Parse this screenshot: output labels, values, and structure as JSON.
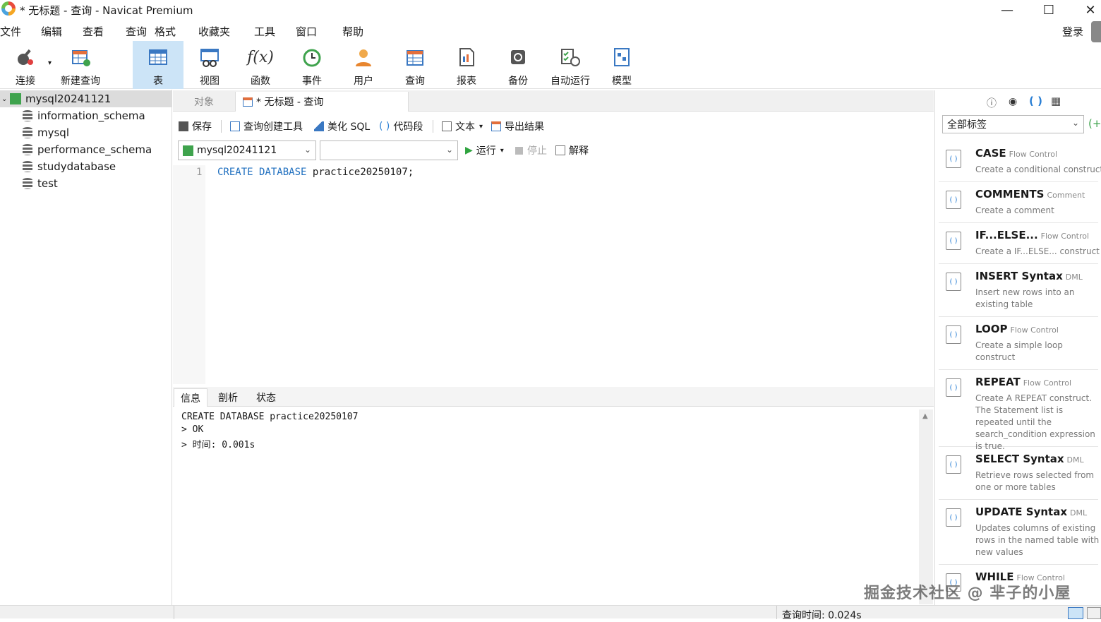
{
  "window": {
    "title": "* 无标题 - 查询 - Navicat Premium"
  },
  "menu": [
    "文件",
    "编辑",
    "查看",
    "查询",
    "格式",
    "收藏夹",
    "工具",
    "窗口",
    "帮助"
  ],
  "login_label": "登录",
  "toolbar": [
    {
      "label": "连接",
      "icon": "plug-icon"
    },
    {
      "label": "新建查询",
      "icon": "new-query-icon"
    },
    {
      "label": "表",
      "icon": "table-icon"
    },
    {
      "label": "视图",
      "icon": "view-icon"
    },
    {
      "label": "函数",
      "icon": "function-icon"
    },
    {
      "label": "事件",
      "icon": "clock-icon"
    },
    {
      "label": "用户",
      "icon": "user-icon"
    },
    {
      "label": "查询",
      "icon": "query-icon"
    },
    {
      "label": "报表",
      "icon": "report-icon"
    },
    {
      "label": "备份",
      "icon": "backup-icon"
    },
    {
      "label": "自动运行",
      "icon": "auto-run-icon"
    },
    {
      "label": "模型",
      "icon": "model-icon"
    }
  ],
  "tree": {
    "connection": "mysql20241121",
    "databases": [
      "information_schema",
      "mysql",
      "performance_schema",
      "studydatabase",
      "test"
    ]
  },
  "tabs": {
    "objects": "对象",
    "query": "* 无标题 - 查询"
  },
  "query_toolbar": {
    "save": "保存",
    "builder": "查询创建工具",
    "beautify": "美化 SQL",
    "snippet": "代码段",
    "text": "文本",
    "export": "导出结果"
  },
  "run_row": {
    "connection": "mysql20241121",
    "database": "",
    "run": "运行",
    "stop": "停止",
    "explain": "解释"
  },
  "editor": {
    "line_number": "1",
    "keyword1": "CREATE",
    "keyword2": "DATABASE",
    "rest": "practice20250107;"
  },
  "result_tabs": [
    "信息",
    "剖析",
    "状态"
  ],
  "result_lines": [
    "CREATE DATABASE practice20250107",
    "> OK",
    "> 时间: 0.001s"
  ],
  "right_panel": {
    "tag_filter": "全部标签",
    "snippets": [
      {
        "title": "CASE",
        "tag": "Flow Control",
        "desc": "Create a conditional construct"
      },
      {
        "title": "COMMENTS",
        "tag": "Comment",
        "desc": "Create a comment"
      },
      {
        "title": "IF...ELSE...",
        "tag": "Flow Control",
        "desc": "Create a IF...ELSE... construct"
      },
      {
        "title": "INSERT Syntax",
        "tag": "DML",
        "desc": "Insert new rows into an existing table"
      },
      {
        "title": "LOOP",
        "tag": "Flow Control",
        "desc": "Create a simple loop construct"
      },
      {
        "title": "REPEAT",
        "tag": "Flow Control",
        "desc": "Create A REPEAT construct. The Statement list is repeated until the search_condition expression is true."
      },
      {
        "title": "SELECT Syntax",
        "tag": "DML",
        "desc": "Retrieve rows selected from one or more tables"
      },
      {
        "title": "UPDATE Syntax",
        "tag": "DML",
        "desc": "Updates columns of existing rows in the named table with new values"
      },
      {
        "title": "WHILE",
        "tag": "Flow Control",
        "desc": ""
      }
    ]
  },
  "status": {
    "query_time": "查询时间: 0.024s"
  },
  "watermark": "掘金技术社区 @ 芈子的小屋",
  "colors": {
    "keyword": "#1f6fbf",
    "accent": "#cce4f7"
  }
}
